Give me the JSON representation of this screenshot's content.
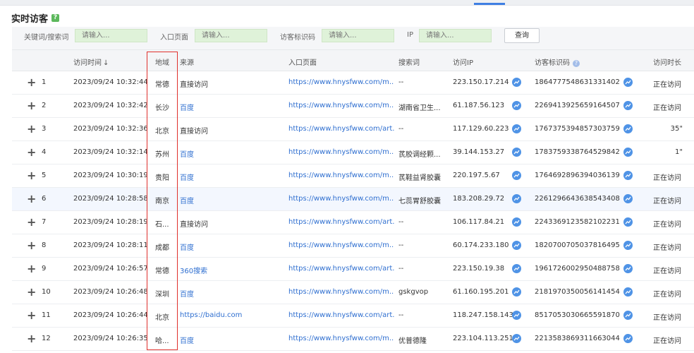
{
  "page": {
    "title": "实时访客",
    "help_icon": "?"
  },
  "filters": {
    "keyword_label": "关键词/搜索词",
    "keyword_placeholder": "请输入...",
    "entry_label": "入口页面",
    "entry_placeholder": "请输入...",
    "visitor_id_label": "访客标识码",
    "visitor_id_placeholder": "请输入...",
    "ip_label": "IP",
    "ip_placeholder": "请输入...",
    "query_button": "查询"
  },
  "columns": {
    "time": "访问时间",
    "sort_arrow": "↓",
    "region": "地域",
    "source": "来源",
    "entry": "入口页面",
    "search_term": "搜索词",
    "ip": "访问IP",
    "visitor_id": "访客标识码",
    "visitor_id_help": "?",
    "duration": "访问时长"
  },
  "expand_icon": "+",
  "trend_icon": "trend-icon",
  "accent_color": "#2f6fd0",
  "highlight_color": "#e0302c",
  "rows": [
    {
      "no": "1",
      "time": "2023/09/24 10:32:44",
      "region": "常德",
      "source": "直接访问",
      "source_link": false,
      "entry": "https://www.hnysfww.com/m...",
      "search": "--",
      "ip": "223.150.17.214",
      "visitor_id": "1864777548631331402",
      "duration": "正在访问",
      "duration_align": "left"
    },
    {
      "no": "2",
      "time": "2023/09/24 10:32:42",
      "region": "长沙",
      "source": "百度",
      "source_link": true,
      "entry": "https://www.hnysfww.com/m...",
      "search": "湖南省卫生...",
      "ip": "61.187.56.123",
      "visitor_id": "2269413925659164507",
      "duration": "正在访问",
      "duration_align": "left"
    },
    {
      "no": "3",
      "time": "2023/09/24 10:32:36",
      "region": "北京",
      "source": "直接访问",
      "source_link": false,
      "entry": "https://www.hnysfww.com/art...",
      "search": "--",
      "ip": "117.129.60.223",
      "visitor_id": "1767375394857303759",
      "duration": "35\"",
      "duration_align": "right"
    },
    {
      "no": "4",
      "time": "2023/09/24 10:32:14",
      "region": "苏州",
      "source": "百度",
      "source_link": true,
      "entry": "https://www.hnysfww.com/m...",
      "search": "芪胶调经颗...",
      "ip": "39.144.153.27",
      "visitor_id": "1783759338764529842",
      "duration": "1\"",
      "duration_align": "right"
    },
    {
      "no": "5",
      "time": "2023/09/24 10:30:19",
      "region": "贵阳",
      "source": "百度",
      "source_link": true,
      "entry": "https://www.hnysfww.com/m...",
      "search": "芪鞋益肾胶囊",
      "ip": "220.197.5.67",
      "visitor_id": "1764692896394036139",
      "duration": "正在访问",
      "duration_align": "left"
    },
    {
      "no": "6",
      "time": "2023/09/24 10:28:58",
      "region": "南京",
      "source": "百度",
      "source_link": true,
      "entry": "https://www.hnysfww.com/m...",
      "search": "七蕊胃舒胶囊",
      "ip": "183.208.29.72",
      "visitor_id": "2261296643638543408",
      "duration": "正在访问",
      "duration_align": "left"
    },
    {
      "no": "7",
      "time": "2023/09/24 10:28:19",
      "region": "石...",
      "source": "直接访问",
      "source_link": false,
      "entry": "https://www.hnysfww.com/art...",
      "search": "--",
      "ip": "106.117.84.21",
      "visitor_id": "2243369123582102231",
      "duration": "正在访问",
      "duration_align": "left"
    },
    {
      "no": "8",
      "time": "2023/09/24 10:28:11",
      "region": "成都",
      "source": "百度",
      "source_link": true,
      "entry": "https://www.hnysfww.com/m...",
      "search": "--",
      "ip": "60.174.233.180",
      "visitor_id": "1820700705037816495",
      "duration": "正在访问",
      "duration_align": "left"
    },
    {
      "no": "9",
      "time": "2023/09/24 10:26:57",
      "region": "常德",
      "source": "360搜索",
      "source_link": true,
      "entry": "https://www.hnysfww.com/art...",
      "search": "--",
      "ip": "223.150.19.38",
      "visitor_id": "1961726002950488758",
      "duration": "正在访问",
      "duration_align": "left"
    },
    {
      "no": "10",
      "time": "2023/09/24 10:26:48",
      "region": "深圳",
      "source": "百度",
      "source_link": true,
      "entry": "https://www.hnysfww.com/m...",
      "search": "gskgvop",
      "ip": "61.160.195.201",
      "visitor_id": "2181970350056141454",
      "duration": "正在访问",
      "duration_align": "left"
    },
    {
      "no": "11",
      "time": "2023/09/24 10:26:44",
      "region": "北京",
      "source": "https://baidu.com",
      "source_link": true,
      "entry": "https://www.hnysfww.com/art...",
      "search": "--",
      "ip": "118.247.158.143",
      "visitor_id": "8517053030665591870",
      "duration": "正在访问",
      "duration_align": "left"
    },
    {
      "no": "12",
      "time": "2023/09/24 10:26:35",
      "region": "哈...",
      "source": "百度",
      "source_link": true,
      "entry": "https://www.hnysfww.com/m...",
      "search": "优普德隆",
      "ip": "223.104.113.251",
      "visitor_id": "2213583869311663044",
      "duration": "正在访问",
      "duration_align": "left"
    }
  ]
}
